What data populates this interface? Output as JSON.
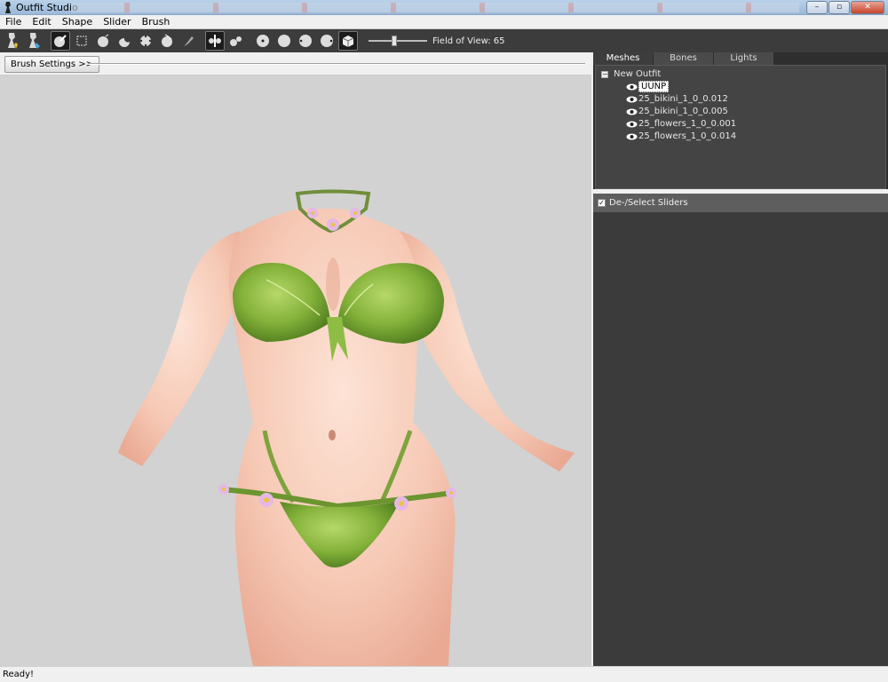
{
  "window": {
    "title": "Outfit Studio"
  },
  "menu": [
    "File",
    "Edit",
    "Shape",
    "Slider",
    "Brush"
  ],
  "toolbar": {
    "tools": [
      "load-outfit-icon",
      "save-outfit-icon",
      "select-brush-icon",
      "mask-brush-icon",
      "inflate-brush-icon",
      "deflate-brush-icon",
      "move-brush-icon",
      "smooth-brush-icon",
      "weight-brush-icon",
      "mirror-x-icon",
      "connected-only-icon",
      "front-view-icon",
      "back-view-icon",
      "left-view-icon",
      "right-view-icon",
      "perspective-icon"
    ],
    "fov_label": "Field of View: 65",
    "fov_value": 65
  },
  "brush_settings": {
    "button_label": "Brush Settings >>"
  },
  "tabs": [
    "Meshes",
    "Bones",
    "Lights"
  ],
  "active_tab": "Meshes",
  "tree": {
    "root": "New Outfit",
    "items": [
      "UUNP",
      "25_bikini_1_0_0.012",
      "25_bikini_1_0_0.005",
      "25_flowers_1_0_0.001",
      "25_flowers_1_0_0.014"
    ],
    "selected": "UUNP"
  },
  "sliders_panel": {
    "header": "De-/Select Sliders"
  },
  "status": {
    "text": "Ready!"
  },
  "colors": {
    "accent": "#3c3c3c",
    "leaf_green": "#7fae35",
    "skin": "#f5c8b4"
  }
}
